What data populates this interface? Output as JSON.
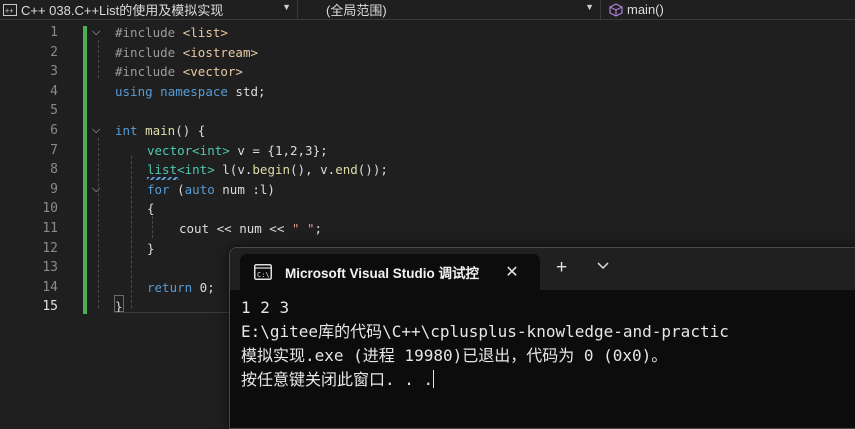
{
  "navbar": {
    "project": "C++ 038.C++List的使用及模拟实现",
    "scope": "(全局范围)",
    "member": "main()"
  },
  "editor": {
    "line_numbers": [
      "1",
      "2",
      "3",
      "4",
      "5",
      "6",
      "7",
      "8",
      "9",
      "10",
      "11",
      "12",
      "13",
      "14",
      "15"
    ],
    "current_line": "15",
    "lines": {
      "l1_directive": "#include",
      "l1_header": "<list>",
      "l2_directive": "#include",
      "l2_header": "<iostream>",
      "l3_directive": "#include",
      "l3_header": "<vector>",
      "l4_using": "using",
      "l4_namespace": "namespace",
      "l4_rest": " std;",
      "l6_type": "int",
      "l6_func": "main",
      "l6_rest": "() {",
      "l7_type": "vector",
      "l7_targ": "<int>",
      "l7_rest": " v = {1,2,3};",
      "l8_type": "list",
      "l8_targ": "<int>",
      "l8_a": " l(v.",
      "l8_begin": "begin",
      "l8_b": "(), v.",
      "l8_end": "end",
      "l8_c": "());",
      "l9_for": "for",
      "l9_open": " (",
      "l9_auto": "auto",
      "l9_rest": " num :l)",
      "l10_brace": "{",
      "l11_a": "cout << num << ",
      "l11_str": "\" \"",
      "l11_b": ";",
      "l12_brace": "}",
      "l14_return": "return",
      "l14_rest": " 0;",
      "l15_brace": "}"
    }
  },
  "console": {
    "tab_title": "Microsoft Visual Studio 调试控",
    "close_symbol": "✕",
    "add_symbol": "+",
    "output": [
      "1 2 3",
      "E:\\gitee库的代码\\C++\\cplusplus-knowledge-and-practic",
      "模拟实现.exe (进程 19980)已退出，代码为 0 (0x0)。",
      "按任意键关闭此窗口. . ."
    ]
  }
}
